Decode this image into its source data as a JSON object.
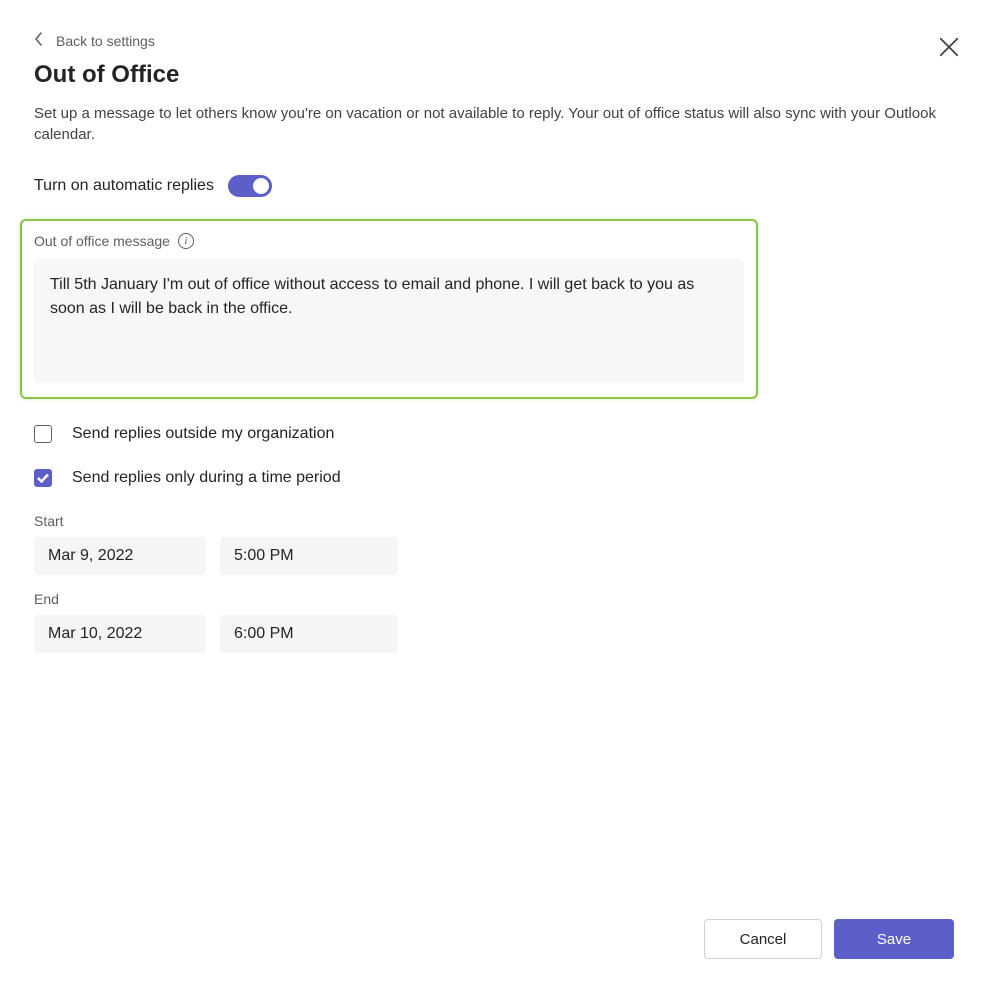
{
  "header": {
    "back_label": "Back to settings",
    "title": "Out of Office",
    "description": "Set up a message to let others know you're on vacation or not available to reply. Your out of office status will also sync with your Outlook calendar."
  },
  "toggle": {
    "label": "Turn on automatic replies",
    "enabled": true
  },
  "message_section": {
    "label": "Out of office message",
    "value": "Till 5th January I'm out of office without access to email and phone. I will get back to you as soon as I will be back in the office."
  },
  "options": {
    "outside_org": {
      "label": "Send replies outside my organization",
      "checked": false
    },
    "time_period": {
      "label": "Send replies only during a time period",
      "checked": true
    }
  },
  "schedule": {
    "start_label": "Start",
    "start_date": "Mar 9, 2022",
    "start_time": "5:00 PM",
    "end_label": "End",
    "end_date": "Mar 10, 2022",
    "end_time": "6:00 PM"
  },
  "footer": {
    "cancel_label": "Cancel",
    "save_label": "Save"
  }
}
